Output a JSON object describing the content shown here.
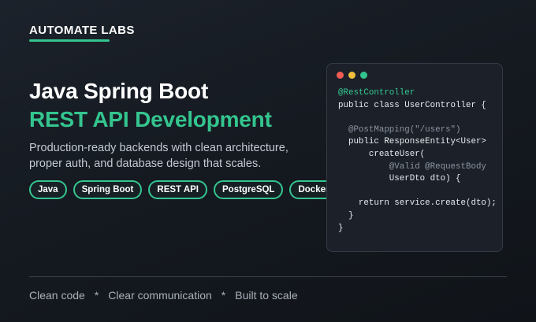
{
  "brand": {
    "name": "AUTOMATE LABS",
    "accent_color": "#34c58f"
  },
  "hero": {
    "title_line1": "Java Spring Boot",
    "title_line2": "REST API Development",
    "subtitle": "Production-ready backends with clean architecture, proper auth, and database design that scales."
  },
  "tags": [
    "Java",
    "Spring Boot",
    "REST API",
    "PostgreSQL",
    "Docker"
  ],
  "code_window": {
    "window_controls": [
      "red",
      "yellow",
      "green"
    ],
    "lines": [
      {
        "indent": "",
        "text": "@RestController",
        "style": "anno"
      },
      {
        "indent": "",
        "text": "public class UserController {",
        "style": "plain"
      },
      {
        "indent": "",
        "text": "",
        "style": "plain"
      },
      {
        "indent": "  ",
        "text": "@PostMapping(\"/users\")",
        "style": "dim"
      },
      {
        "indent": "  ",
        "text": "public ResponseEntity<User>",
        "style": "plain"
      },
      {
        "indent": "      ",
        "text": "createUser(",
        "style": "plain"
      },
      {
        "indent": "          ",
        "text": "@Valid @RequestBody",
        "style": "dim"
      },
      {
        "indent": "          ",
        "text": "UserDto dto) {",
        "style": "plain"
      },
      {
        "indent": "",
        "text": "",
        "style": "plain"
      },
      {
        "indent": "    ",
        "text": "return service.create(dto);",
        "style": "plain"
      },
      {
        "indent": "  ",
        "text": "}",
        "style": "plain"
      },
      {
        "indent": "",
        "text": "}",
        "style": "plain"
      }
    ]
  },
  "footer": {
    "items": [
      "Clean code",
      "Clear communication",
      "Built to scale"
    ],
    "separator": "*"
  }
}
